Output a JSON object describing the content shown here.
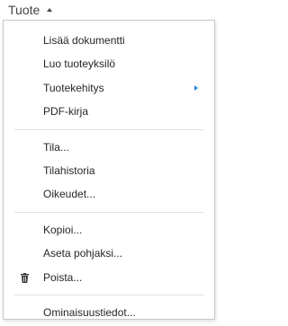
{
  "menu": {
    "title": "Tuote",
    "groups": [
      {
        "items": [
          {
            "label": "Lisää dokumentti"
          },
          {
            "label": "Luo tuoteyksilö"
          },
          {
            "label": "Tuotekehitys",
            "submenu_icon": "chevron-right-icon"
          },
          {
            "label": "PDF-kirja"
          }
        ]
      },
      {
        "items": [
          {
            "label": "Tila..."
          },
          {
            "label": "Tilahistoria"
          },
          {
            "label": "Oikeudet..."
          }
        ]
      },
      {
        "items": [
          {
            "label": "Kopioi..."
          },
          {
            "label": "Aseta pohjaksi..."
          },
          {
            "label": "Poista...",
            "icon": "trash-icon"
          }
        ]
      },
      {
        "items": [
          {
            "label": "Ominaisuustiedot..."
          }
        ]
      }
    ]
  },
  "colors": {
    "text": "#262626",
    "accent_arrow": "#2b88d8",
    "border": "#c8c8c8",
    "separator": "#e0e0e0"
  }
}
